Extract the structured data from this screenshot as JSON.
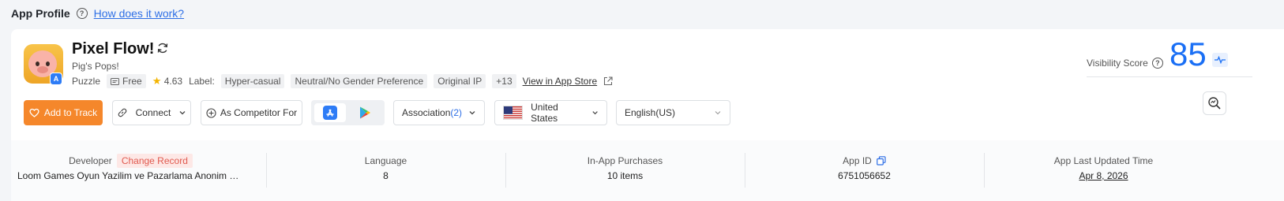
{
  "header": {
    "title": "App Profile",
    "help_link": "How does it work?"
  },
  "app": {
    "name": "Pixel Flow!",
    "subtitle": "Pig's Pops!",
    "category": "Puzzle",
    "price": "Free",
    "rating": "4.63",
    "label_prefix": "Label:",
    "labels": [
      "Hyper-casual",
      "Neutral/No Gender Preference",
      "Original IP",
      "+13"
    ],
    "store_link": "View in App Store"
  },
  "visibility": {
    "label": "Visibility Score",
    "score": "85"
  },
  "actions": {
    "add_to_track": "Add to Track",
    "connect": "Connect",
    "competitor": "As Competitor For",
    "association_label": "Association",
    "association_count": "(2)",
    "country": "United States",
    "language": "English(US)"
  },
  "stats": {
    "developer_label": "Developer",
    "change_record": "Change Record",
    "developer_value": "Loom Games Oyun Yazilim ve Pazarlama Anonim Sirketi",
    "language_label": "Language",
    "language_value": "8",
    "iap_label": "In-App Purchases",
    "iap_value": "10 items",
    "app_id_label": "App ID",
    "app_id_value": "6751056652",
    "updated_label": "App Last Updated Time",
    "updated_value": "Apr 8, 2026"
  },
  "colors": {
    "accent": "#1a6ff5",
    "track_button": "#f5872b",
    "link": "#2e6fe6"
  }
}
